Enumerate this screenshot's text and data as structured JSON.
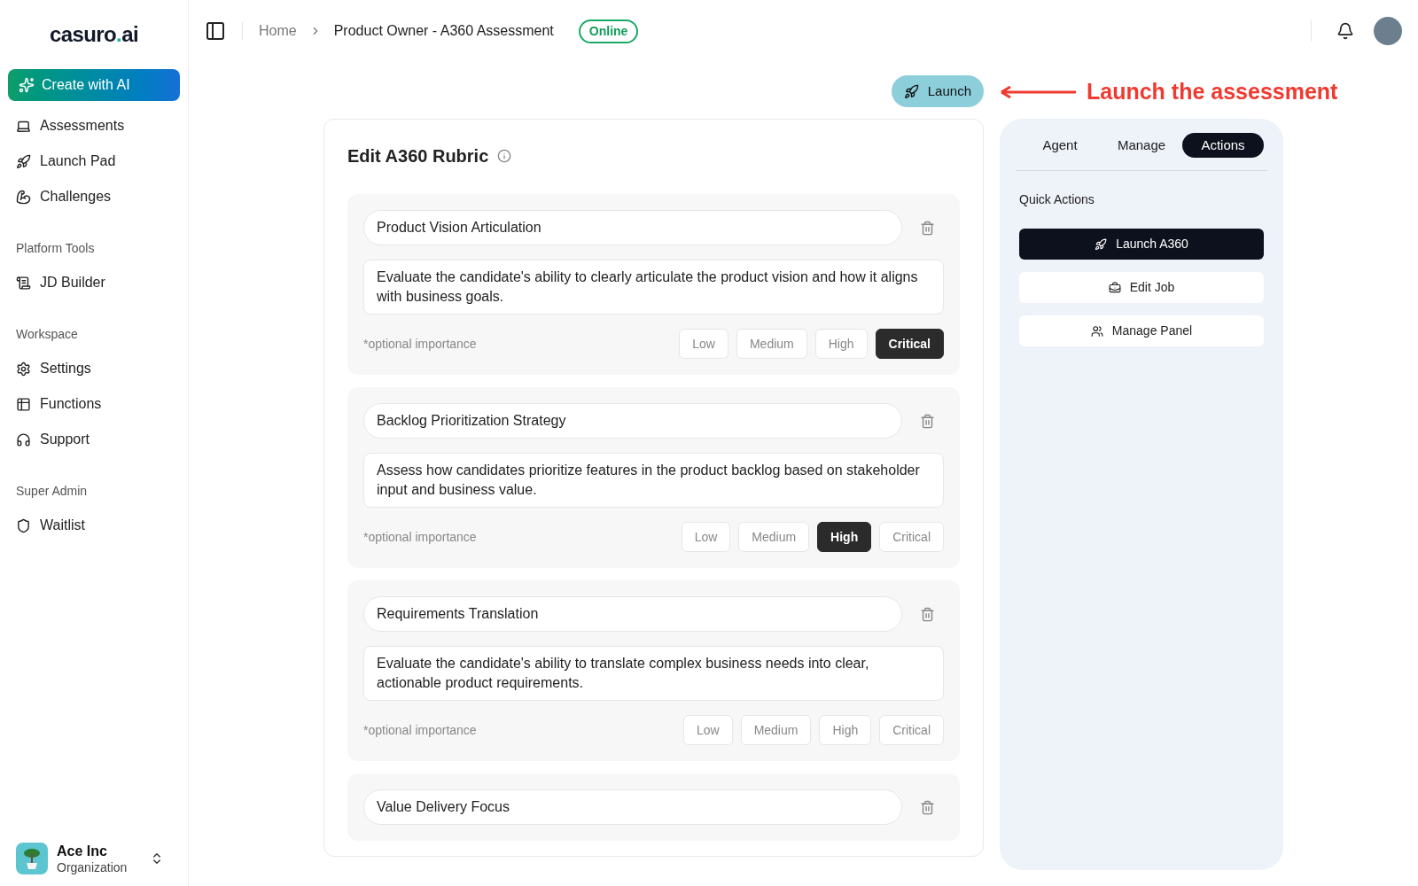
{
  "logo": {
    "text": "casuro",
    "dot": ".",
    "suffix": "ai"
  },
  "create_button": "Create with AI",
  "nav": [
    {
      "kind": "item",
      "label": "Assessments"
    },
    {
      "kind": "item",
      "label": "Launch Pad"
    },
    {
      "kind": "item",
      "label": "Challenges"
    },
    {
      "kind": "section",
      "label": "Platform Tools"
    },
    {
      "kind": "item",
      "label": "JD Builder"
    },
    {
      "kind": "section",
      "label": "Workspace"
    },
    {
      "kind": "item",
      "label": "Settings"
    },
    {
      "kind": "item",
      "label": "Functions"
    },
    {
      "kind": "item",
      "label": "Support"
    },
    {
      "kind": "section",
      "label": "Super Admin"
    },
    {
      "kind": "item",
      "label": "Waitlist"
    }
  ],
  "org": {
    "name": "Ace Inc",
    "role": "Organization"
  },
  "breadcrumb": [
    "Home",
    "Product Owner - A360 Assessment"
  ],
  "status_badge": "Online",
  "launch_button": "Launch",
  "annotation": "Launch the assessment",
  "editor": {
    "title": "Edit A360 Rubric",
    "criteria": [
      {
        "title": "Product Vision Articulation",
        "description": "Evaluate the candidate's ability to clearly articulate the product vision and how it aligns with business goals.",
        "hint": "*optional importance",
        "levels": [
          {
            "label": "Low",
            "selected": false
          },
          {
            "label": "Medium",
            "selected": false
          },
          {
            "label": "High",
            "selected": false
          },
          {
            "label": "Critical",
            "selected": true
          }
        ]
      },
      {
        "title": "Backlog Prioritization Strategy",
        "description": "Assess how candidates prioritize features in the product backlog based on stakeholder input and business value.",
        "hint": "*optional importance",
        "levels": [
          {
            "label": "Low",
            "selected": false
          },
          {
            "label": "Medium",
            "selected": false
          },
          {
            "label": "High",
            "selected": true
          },
          {
            "label": "Critical",
            "selected": false
          }
        ]
      },
      {
        "title": "Requirements Translation",
        "description": "Evaluate the candidate's ability to translate complex business needs into clear, actionable product requirements.",
        "hint": "*optional importance",
        "levels": [
          {
            "label": "Low",
            "selected": false
          },
          {
            "label": "Medium",
            "selected": false
          },
          {
            "label": "High",
            "selected": false
          },
          {
            "label": "Critical",
            "selected": false
          }
        ]
      },
      {
        "title": "Value Delivery Focus"
      }
    ]
  },
  "panel": {
    "tabs": [
      {
        "label": "Agent",
        "selected": false
      },
      {
        "label": "Manage",
        "selected": false
      },
      {
        "label": "Actions",
        "selected": true
      }
    ],
    "section": "Quick Actions",
    "actions": [
      {
        "kind": "primary",
        "label": "Launch A360"
      },
      {
        "kind": "secondary",
        "label": "Edit Job"
      },
      {
        "kind": "secondary",
        "label": "Manage Panel"
      }
    ]
  }
}
